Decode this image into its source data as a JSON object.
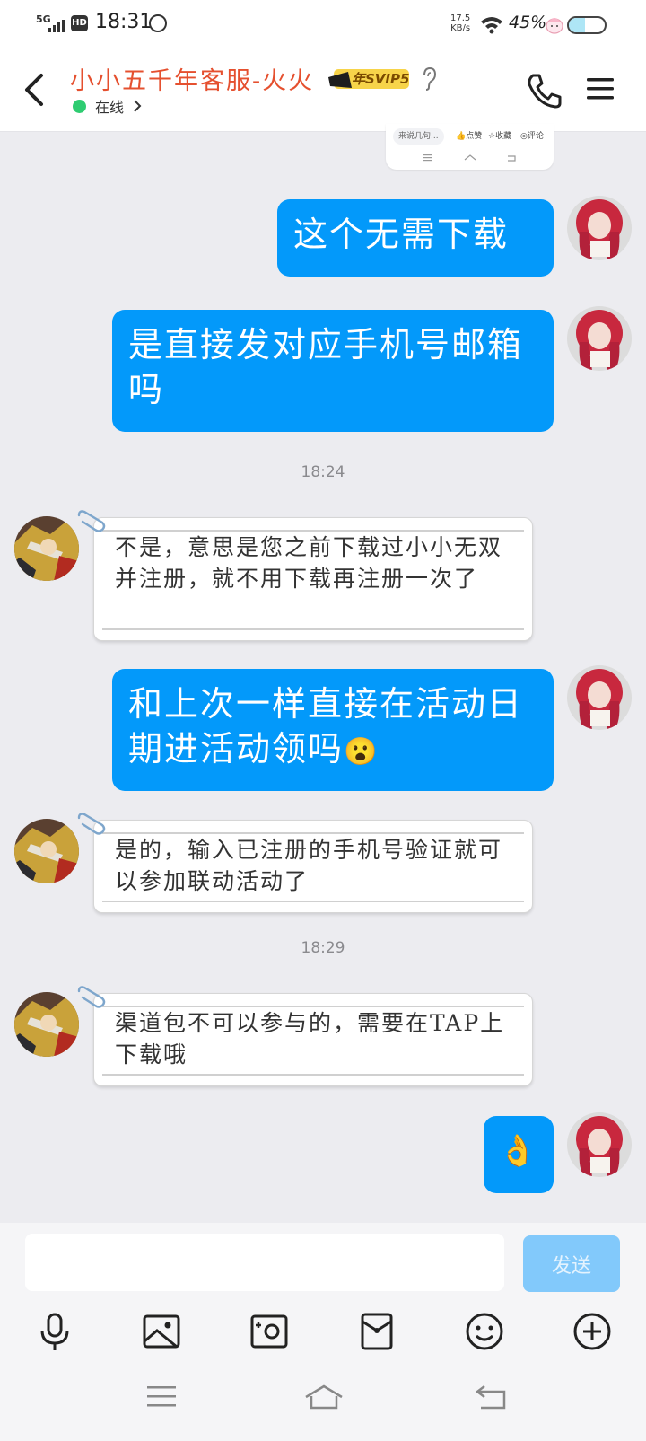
{
  "status_bar": {
    "network": "5G",
    "hd": "HD",
    "time": "18:31",
    "speed_value": "17.5",
    "speed_unit": "KB/s",
    "battery_percent": "45%",
    "battery_level": 0.45
  },
  "header": {
    "contact_name": "小小五千年客服-火火",
    "vip_badge": "年SVIP5",
    "status": "在线"
  },
  "shared_card": {
    "preview_text": "来说几句...",
    "actions": [
      "点赞",
      "收藏",
      "评论"
    ]
  },
  "messages": [
    {
      "sender": "me",
      "text": "这个无需下载"
    },
    {
      "sender": "me",
      "text": "是直接发对应手机号邮箱吗"
    },
    {
      "type": "time",
      "text": "18:24"
    },
    {
      "sender": "them",
      "text": "不是，意思是您之前下载过小小无双并注册，就不用下载再注册一次了"
    },
    {
      "sender": "me",
      "text": "和上次一样直接在活动日期进活动领吗",
      "emoji": "😮"
    },
    {
      "sender": "them",
      "text": "是的，输入已注册的手机号验证就可以参加联动活动了"
    },
    {
      "type": "time",
      "text": "18:29"
    },
    {
      "sender": "them",
      "text": "渠道包不可以参与的，需要在TAP上下载哦"
    },
    {
      "sender": "me",
      "text": "👌"
    }
  ],
  "input": {
    "placeholder": "",
    "send_label": "发送"
  },
  "colors": {
    "my_bubble": "#0399fa",
    "name_red": "#e5502f",
    "online_green": "#2ecc71",
    "send_disabled": "#82c9fb"
  },
  "toolbar_icons": [
    "microphone-icon",
    "image-icon",
    "camera-icon",
    "red-packet-icon",
    "emoji-icon",
    "plus-icon"
  ],
  "nav_icons": [
    "menu-icon",
    "home-icon",
    "back-icon"
  ]
}
